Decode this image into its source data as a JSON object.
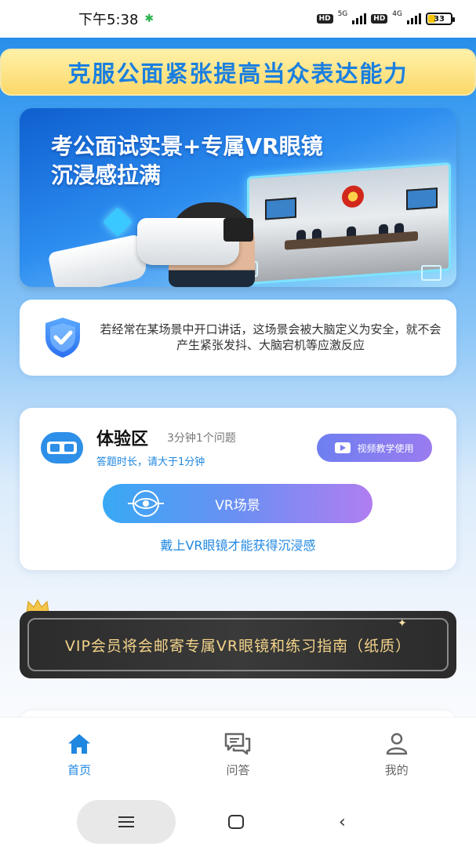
{
  "status_bar": {
    "time": "下午5:38",
    "net1": "5G",
    "net2": "4G",
    "hd": "HD",
    "battery": "33"
  },
  "header": {
    "banner_text": "克服公面紧张提高当众表达能力"
  },
  "hero": {
    "title_line1": "考公面试实景+专属VR眼镜",
    "title_line2": "沉浸感拉满"
  },
  "info": {
    "text": "若经常在某场景中开口讲话，这场景会被大脑定义为安全，就不会产生紧张发抖、大脑宕机等应激反应"
  },
  "experience": {
    "title": "体验区",
    "subtitle": "3分钟1个问题",
    "hint": "答题时长，请大于1分钟",
    "video_button": "视频教学使用",
    "vr_button": "VR场景",
    "note": "戴上VR眼镜才能获得沉浸感"
  },
  "vip": {
    "text": "VIP会员将会邮寄专属VR眼镜和练习指南（纸质）"
  },
  "bottom_nav": {
    "items": [
      {
        "label": "首页",
        "icon": "home-icon",
        "active": true
      },
      {
        "label": "问答",
        "icon": "chat-icon",
        "active": false
      },
      {
        "label": "我的",
        "icon": "user-icon",
        "active": false
      }
    ]
  },
  "colors": {
    "accent": "#1f87e0",
    "banner_text": "#1a7fe0",
    "vip_gold": "#f3d38a"
  }
}
